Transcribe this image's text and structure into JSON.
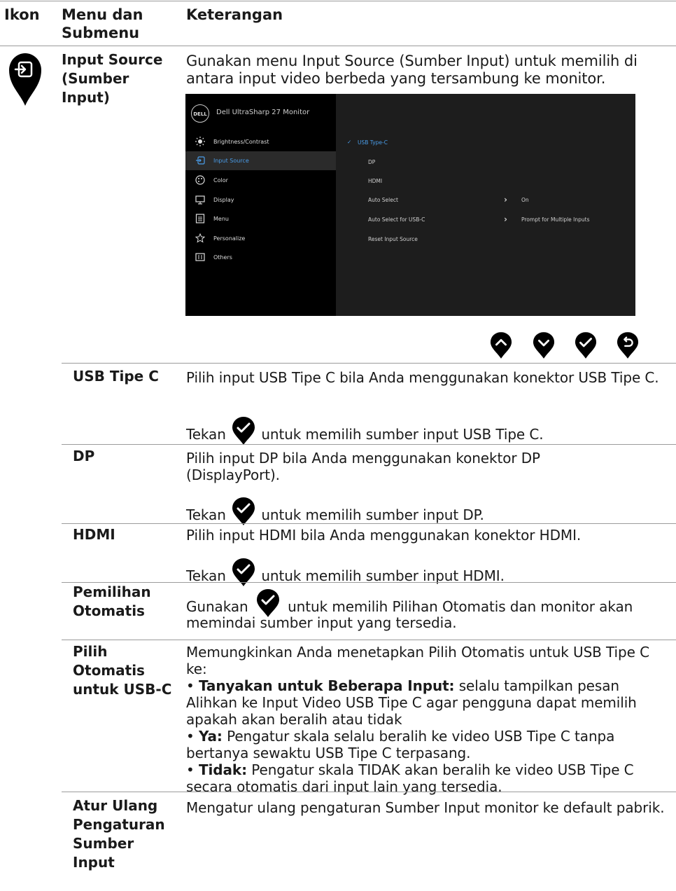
{
  "header": {
    "col1": "Ikon",
    "col2": "Menu dan Submenu",
    "col3": "Keterangan"
  },
  "input_source": {
    "name": "Input Source (Sumber Input)",
    "desc": "Gunakan menu Input Source (Sumber Input) untuk memilih di antara input video berbeda yang tersambung ke monitor."
  },
  "osd": {
    "brand": "DELL",
    "title": "Dell UltraSharp 27 Monitor",
    "menu": [
      {
        "label": "Brightness/Contrast",
        "icon": "brightness-icon"
      },
      {
        "label": "Input Source",
        "icon": "input-source-icon"
      },
      {
        "label": "Color",
        "icon": "color-palette-icon"
      },
      {
        "label": "Display",
        "icon": "display-icon"
      },
      {
        "label": "Menu",
        "icon": "menu-icon"
      },
      {
        "label": "Personalize",
        "icon": "star-icon"
      },
      {
        "label": "Others",
        "icon": "others-icon"
      }
    ],
    "options": [
      {
        "label": "USB Type-C",
        "value": ""
      },
      {
        "label": "DP",
        "value": ""
      },
      {
        "label": "HDMI",
        "value": ""
      },
      {
        "label": "Auto Select",
        "value": "On"
      },
      {
        "label": "Auto Select for USB-C",
        "value": "Prompt for Multiple Inputs"
      },
      {
        "label": "Reset Input Source",
        "value": ""
      }
    ]
  },
  "rows": {
    "usbc": {
      "name": "USB Tipe C",
      "desc": "Pilih input USB Tipe C bila Anda menggunakan konektor USB Tipe C.",
      "press_pre": "Tekan",
      "press_post": "untuk memilih sumber input USB Tipe C."
    },
    "dp": {
      "name": "DP",
      "desc": "Pilih input DP bila Anda menggunakan konektor DP (DisplayPort).",
      "press_pre": "Tekan",
      "press_post": "untuk memilih sumber input DP."
    },
    "hdmi": {
      "name": "HDMI",
      "desc": "Pilih input HDMI bila Anda menggunakan konektor HDMI.",
      "press_pre": "Tekan",
      "press_post": "untuk memilih sumber input HDMI."
    },
    "auto": {
      "name": "Pemilihan Otomatis",
      "pre": "Gunakan",
      "post": "untuk memilih Pilihan Otomatis dan monitor akan",
      "line2": "memindai sumber input yang tersedia."
    },
    "autousbc": {
      "name": "Pilih Otomatis untuk USB-C",
      "intro": "Memungkinkan Anda menetapkan Pilih Otomatis untuk USB Tipe C ke:",
      "b1_label": "Tanyakan untuk Beberapa Input:",
      "b1_text": "selalu tampilkan pesan Alihkan ke Input Video USB Tipe C agar pengguna dapat memilih apakah akan beralih atau tidak",
      "b2_label": "Ya:",
      "b2_text": "Pengatur skala selalu beralih ke video USB Tipe C tanpa bertanya sewaktu USB Tipe C terpasang.",
      "b3_label": "Tidak:",
      "b3_text": "Pengatur skala TIDAK akan beralih ke video USB Tipe C secara otomatis dari input lain yang tersedia."
    },
    "reset": {
      "name": "Atur Ulang Pengaturan Sumber Input",
      "desc": "Mengatur ulang pengaturan Sumber Input monitor ke default pabrik."
    }
  }
}
